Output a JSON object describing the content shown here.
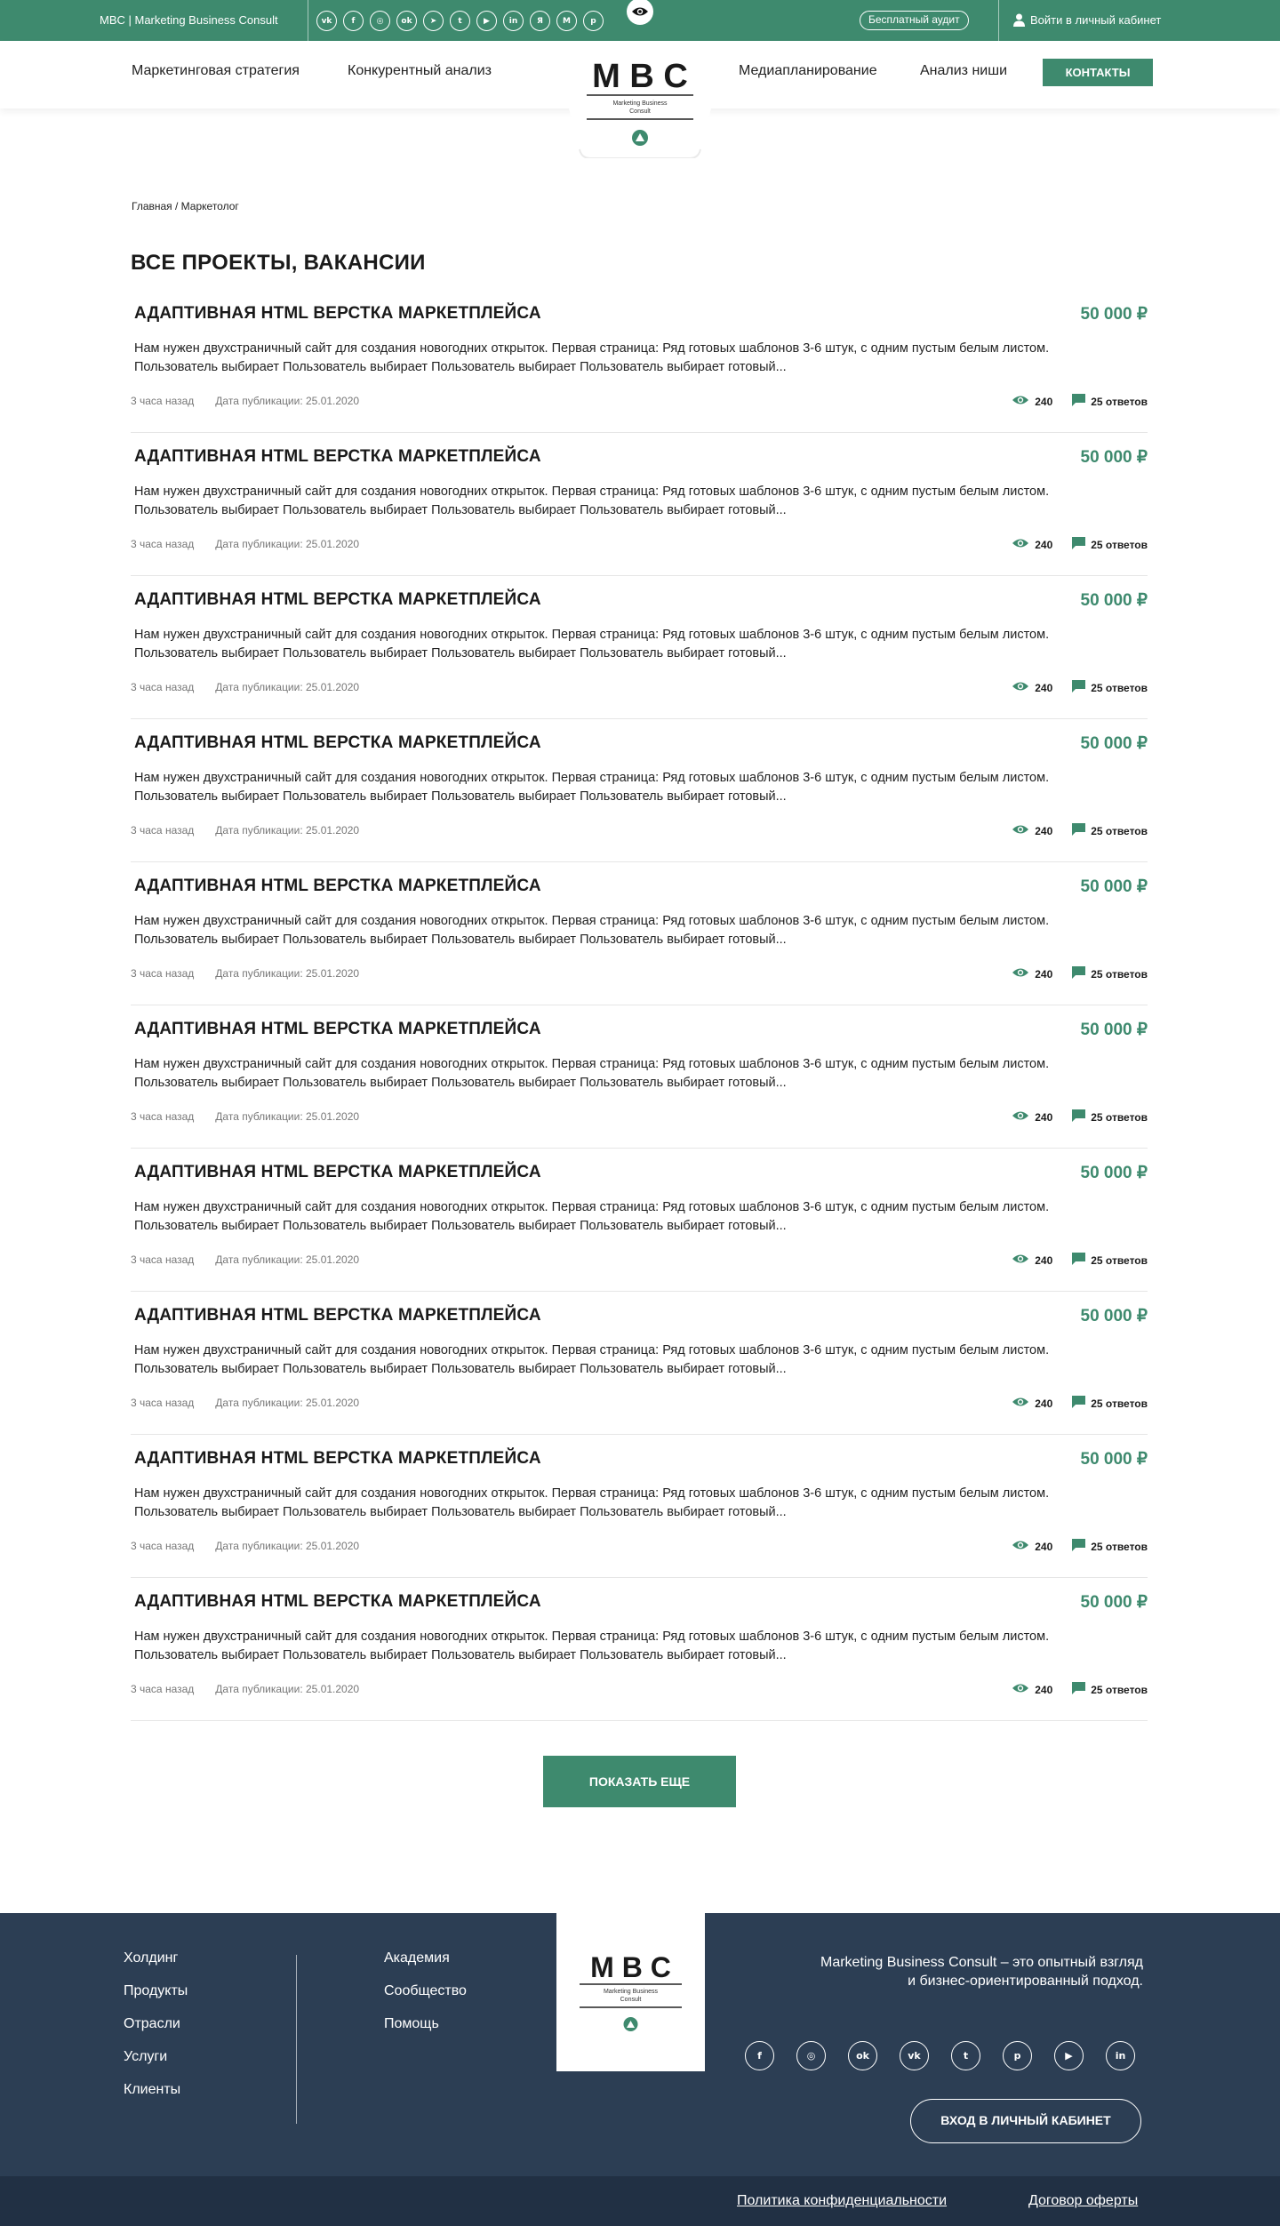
{
  "topbar": {
    "brand": "MBC | Marketing Business Consult",
    "socials": [
      {
        "icon": "vk-icon",
        "glyph": "vk"
      },
      {
        "icon": "facebook-icon",
        "glyph": "f"
      },
      {
        "icon": "instagram-icon",
        "glyph": "◎"
      },
      {
        "icon": "odnoklassniki-icon",
        "glyph": "ok"
      },
      {
        "icon": "telegram-icon",
        "glyph": "➤"
      },
      {
        "icon": "twitter-icon",
        "glyph": "t"
      },
      {
        "icon": "youtube-icon",
        "glyph": "▶"
      },
      {
        "icon": "linkedin-icon",
        "glyph": "in"
      },
      {
        "icon": "yandex-zen-icon",
        "glyph": "Я"
      },
      {
        "icon": "medium-icon",
        "glyph": "M"
      },
      {
        "icon": "pinterest-icon",
        "glyph": "p"
      }
    ],
    "audit": "Бесплатный аудит",
    "login": "Войти в личный кабинет"
  },
  "nav": {
    "left": [
      "Маркетинговая стратегия",
      "Конкурентный анализ"
    ],
    "right": [
      "Медиапланирование",
      "Анализ ниши"
    ],
    "contacts": "КОНТАКТЫ"
  },
  "logo": {
    "letters": "M B C",
    "caption_1": "Marketing Business",
    "caption_2": "Consult"
  },
  "breadcrumb": "Главная / Маркетолог",
  "page_title": "ВСЕ ПРОЕКТЫ, ВАКАНСИИ",
  "jobs": [
    {
      "title": "АДАПТИВНАЯ HTML ВЕРСТКА МАРКЕТПЛЕЙСА",
      "price": "50 000 ₽",
      "desc": "Нам нужен двухстраничный сайт для создания новогодних открыток. Первая страница: Ряд готовых шаблонов 3-6 штук, с одним пустым белым листом. Пользователь выбирает Пользователь выбирает Пользователь выбирает Пользователь выбирает готовый...",
      "ago": "3 часа назад",
      "date": "Дата публикации: 25.01.2020",
      "views": "240",
      "answers": "25 ответов"
    },
    {
      "title": "АДАПТИВНАЯ HTML ВЕРСТКА МАРКЕТПЛЕЙСА",
      "price": "50 000 ₽",
      "desc": "Нам нужен двухстраничный сайт для создания новогодних открыток. Первая страница: Ряд готовых шаблонов 3-6 штук, с одним пустым белым листом. Пользователь выбирает Пользователь выбирает Пользователь выбирает Пользователь выбирает готовый...",
      "ago": "3 часа назад",
      "date": "Дата публикации: 25.01.2020",
      "views": "240",
      "answers": "25 ответов"
    },
    {
      "title": "АДАПТИВНАЯ HTML ВЕРСТКА МАРКЕТПЛЕЙСА",
      "price": "50 000 ₽",
      "desc": "Нам нужен двухстраничный сайт для создания новогодних открыток. Первая страница: Ряд готовых шаблонов 3-6 штук, с одним пустым белым листом. Пользователь выбирает Пользователь выбирает Пользователь выбирает Пользователь выбирает готовый...",
      "ago": "3 часа назад",
      "date": "Дата публикации: 25.01.2020",
      "views": "240",
      "answers": "25 ответов"
    },
    {
      "title": "АДАПТИВНАЯ HTML ВЕРСТКА МАРКЕТПЛЕЙСА",
      "price": "50 000 ₽",
      "desc": "Нам нужен двухстраничный сайт для создания новогодних открыток. Первая страница: Ряд готовых шаблонов 3-6 штук, с одним пустым белым листом. Пользователь выбирает Пользователь выбирает Пользователь выбирает Пользователь выбирает готовый...",
      "ago": "3 часа назад",
      "date": "Дата публикации: 25.01.2020",
      "views": "240",
      "answers": "25 ответов"
    },
    {
      "title": "АДАПТИВНАЯ HTML ВЕРСТКА МАРКЕТПЛЕЙСА",
      "price": "50 000 ₽",
      "desc": "Нам нужен двухстраничный сайт для создания новогодних открыток. Первая страница: Ряд готовых шаблонов 3-6 штук, с одним пустым белым листом. Пользователь выбирает Пользователь выбирает Пользователь выбирает Пользователь выбирает готовый...",
      "ago": "3 часа назад",
      "date": "Дата публикации: 25.01.2020",
      "views": "240",
      "answers": "25 ответов"
    },
    {
      "title": "АДАПТИВНАЯ HTML ВЕРСТКА МАРКЕТПЛЕЙСА",
      "price": "50 000 ₽",
      "desc": "Нам нужен двухстраничный сайт для создания новогодних открыток. Первая страница: Ряд готовых шаблонов 3-6 штук, с одним пустым белым листом. Пользователь выбирает Пользователь выбирает Пользователь выбирает Пользователь выбирает готовый...",
      "ago": "3 часа назад",
      "date": "Дата публикации: 25.01.2020",
      "views": "240",
      "answers": "25 ответов"
    },
    {
      "title": "АДАПТИВНАЯ HTML ВЕРСТКА МАРКЕТПЛЕЙСА",
      "price": "50 000 ₽",
      "desc": "Нам нужен двухстраничный сайт для создания новогодних открыток. Первая страница: Ряд готовых шаблонов 3-6 штук, с одним пустым белым листом. Пользователь выбирает Пользователь выбирает Пользователь выбирает Пользователь выбирает готовый...",
      "ago": "3 часа назад",
      "date": "Дата публикации: 25.01.2020",
      "views": "240",
      "answers": "25 ответов"
    },
    {
      "title": "АДАПТИВНАЯ HTML ВЕРСТКА МАРКЕТПЛЕЙСА",
      "price": "50 000 ₽",
      "desc": "Нам нужен двухстраничный сайт для создания новогодних открыток. Первая страница: Ряд готовых шаблонов 3-6 штук, с одним пустым белым листом. Пользователь выбирает Пользователь выбирает Пользователь выбирает Пользователь выбирает готовый...",
      "ago": "3 часа назад",
      "date": "Дата публикации: 25.01.2020",
      "views": "240",
      "answers": "25 ответов"
    },
    {
      "title": "АДАПТИВНАЯ HTML ВЕРСТКА МАРКЕТПЛЕЙСА",
      "price": "50 000 ₽",
      "desc": "Нам нужен двухстраничный сайт для создания новогодних открыток. Первая страница: Ряд готовых шаблонов 3-6 штук, с одним пустым белым листом. Пользователь выбирает Пользователь выбирает Пользователь выбирает Пользователь выбирает готовый...",
      "ago": "3 часа назад",
      "date": "Дата публикации: 25.01.2020",
      "views": "240",
      "answers": "25 ответов"
    },
    {
      "title": "АДАПТИВНАЯ HTML ВЕРСТКА МАРКЕТПЛЕЙСА",
      "price": "50 000 ₽",
      "desc": "Нам нужен двухстраничный сайт для создания новогодних открыток. Первая страница: Ряд готовых шаблонов 3-6 штук, с одним пустым белым листом. Пользователь выбирает Пользователь выбирает Пользователь выбирает Пользователь выбирает готовый...",
      "ago": "3 часа назад",
      "date": "Дата публикации: 25.01.2020",
      "views": "240",
      "answers": "25 ответов"
    }
  ],
  "show_more": "ПОКАЗАТЬ ЕЩЕ",
  "footer": {
    "col1": [
      "Холдинг",
      "Продукты",
      "Отрасли",
      "Услуги",
      "Клиенты"
    ],
    "col2": [
      "Академия",
      "Сообщество",
      "Помощь"
    ],
    "about_1": "Marketing Business Consult – это опытный взгляд",
    "about_2": "и бизнес-ориентированный подход.",
    "socials": [
      {
        "icon": "facebook-icon",
        "glyph": "f"
      },
      {
        "icon": "instagram-icon",
        "glyph": "◎"
      },
      {
        "icon": "odnoklassniki-icon",
        "glyph": "ok"
      },
      {
        "icon": "vk-icon",
        "glyph": "vk"
      },
      {
        "icon": "twitter-icon",
        "glyph": "t"
      },
      {
        "icon": "pinterest-icon",
        "glyph": "p"
      },
      {
        "icon": "youtube-icon",
        "glyph": "▶"
      },
      {
        "icon": "linkedin-icon",
        "glyph": "in"
      }
    ],
    "login": "ВХОД В ЛИЧНЫЙ КАБИНЕТ",
    "privacy": "Политика конфиденциальности",
    "offer": "Договор оферты"
  },
  "colors": {
    "accent": "#3e8a6e",
    "footer": "#2c3e54",
    "footer_bottom": "#213044"
  }
}
